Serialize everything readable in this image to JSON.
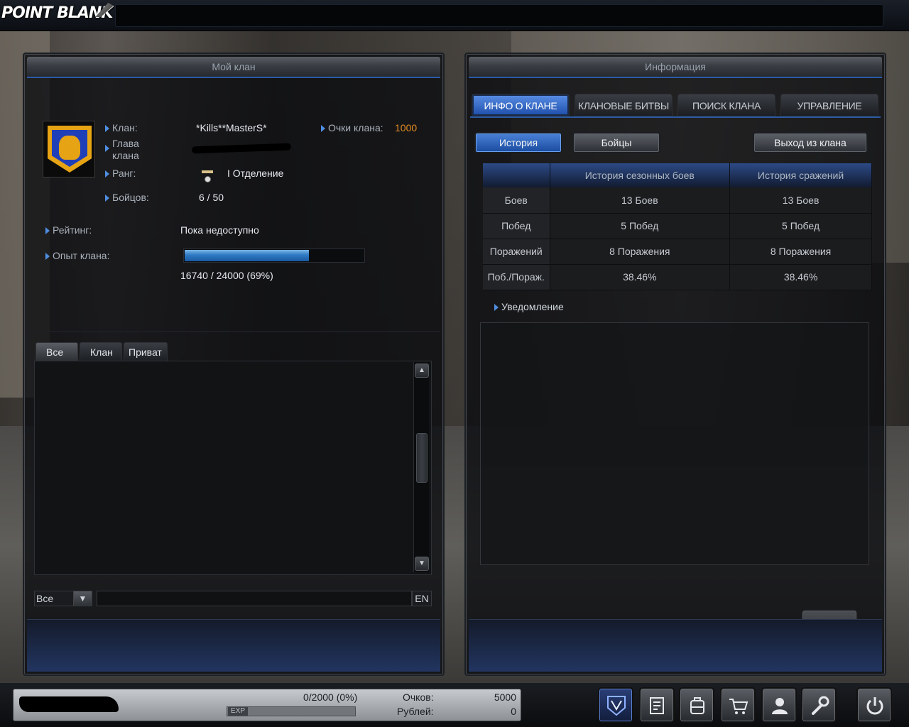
{
  "app": {
    "logo": "POINT BLANK"
  },
  "left_panel": {
    "title": "Мой клан",
    "clan_label": "Клан:",
    "clan_name": "*Kills**MasterS*",
    "points_label": "Очки клана:",
    "points_value": "1000",
    "leader_label": "Глава клана",
    "rank_label": "Ранг:",
    "rank_value": "I Отделение",
    "fighters_label": "Бойцов:",
    "fighters_value": "6 / 50",
    "rating_label": "Рейтинг:",
    "rating_value": "Пока недоступно",
    "exp_label": "Опыт клана:",
    "exp_text": "16740 / 24000 (69%)",
    "exp_fraction": 0.69,
    "chat_tabs": [
      "Все",
      "Клан",
      "Приват"
    ],
    "chat_channel": "Все",
    "lang": "EN"
  },
  "right_panel": {
    "title": "Информация",
    "tabs": [
      "ИНФО О КЛАНЕ",
      "КЛАНОВЫЕ БИТВЫ",
      "ПОИСК КЛАНА",
      "УПРАВЛЕНИЕ"
    ],
    "sub_buttons": {
      "history": "История",
      "fighters": "Бойцы",
      "leave": "Выход из клана"
    },
    "table": {
      "headers": [
        "",
        "История сезонных боев",
        "История сражений"
      ],
      "rows": [
        [
          "Боев",
          "13 Боев",
          "13 Боев"
        ],
        [
          "Побед",
          "5 Побед",
          "5 Побед"
        ],
        [
          "Поражений",
          "8 Поражения",
          "8 Поражения"
        ],
        [
          "Поб./Пораж.",
          "38.46%",
          "38.46%"
        ]
      ]
    },
    "notification_label": "Уведомление",
    "exit_label": "выход"
  },
  "bottom_bar": {
    "exp_text": "0/2000 (0%)",
    "exp_tag": "EXP",
    "points_label": "Очков:",
    "points_value": "5000",
    "rubles_label": "Рублей:",
    "rubles_value": "0",
    "icons": [
      "clan-icon",
      "notes-icon",
      "backpack-icon",
      "shop-cart-icon",
      "community-icon",
      "settings-wrench-icon",
      "power-icon"
    ]
  }
}
